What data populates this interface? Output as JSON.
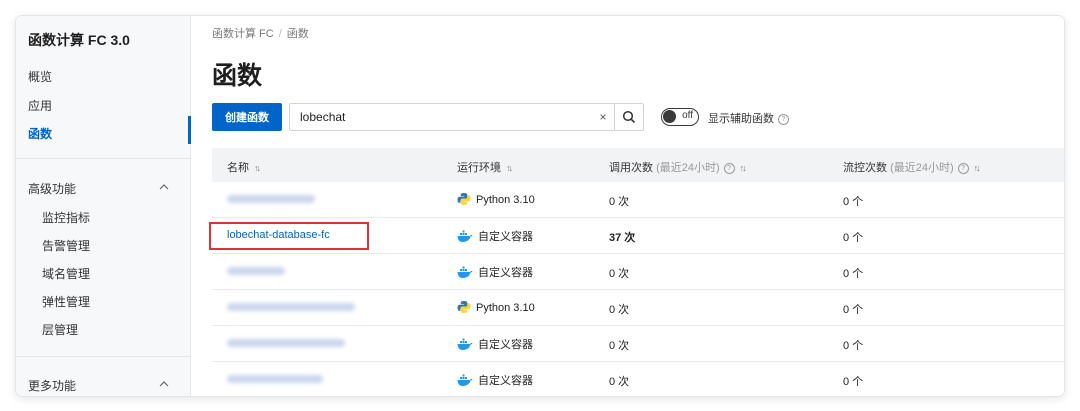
{
  "sidebar": {
    "title": "函数计算 FC 3.0",
    "items": [
      {
        "label": "概览"
      },
      {
        "label": "应用"
      },
      {
        "label": "函数"
      }
    ],
    "sections": [
      {
        "label": "高级功能",
        "items": [
          "监控指标",
          "告警管理",
          "域名管理",
          "弹性管理",
          "层管理"
        ]
      },
      {
        "label": "更多功能"
      }
    ]
  },
  "breadcrumb": {
    "root": "函数计算 FC",
    "separator": "/",
    "current": "函数"
  },
  "page": {
    "title": "函数"
  },
  "toolbar": {
    "create_label": "创建函数",
    "search_value": "lobechat",
    "clear_glyph": "×",
    "toggle_state": "off",
    "toggle_label": "显示辅助函数",
    "help_glyph": "?"
  },
  "table": {
    "headers": {
      "name": "名称",
      "runtime": "运行环境",
      "invocations": "调用次数",
      "invocations_sub": "(最近24小时)",
      "throttles": "流控次数",
      "throttles_sub": "(最近24小时)",
      "sort_glyph": "↑↓"
    },
    "rows": [
      {
        "runtime": "Python 3.10",
        "runtime_icon": "python-icon",
        "invocations": "0 次",
        "throttles": "0 个"
      },
      {
        "name": "lobechat-database-fc",
        "runtime": "自定义容器",
        "runtime_icon": "docker-icon",
        "invocations": "37 次",
        "throttles": "0 个"
      },
      {
        "runtime": "自定义容器",
        "runtime_icon": "docker-icon",
        "invocations": "0 次",
        "throttles": "0 个"
      },
      {
        "runtime": "Python 3.10",
        "runtime_icon": "python-icon",
        "invocations": "0 次",
        "throttles": "0 个"
      },
      {
        "runtime": "自定义容器",
        "runtime_icon": "docker-icon",
        "invocations": "0 次",
        "throttles": "0 个"
      },
      {
        "runtime": "自定义容器",
        "runtime_icon": "docker-icon",
        "invocations": "0 次",
        "throttles": "0 个"
      }
    ]
  },
  "colors": {
    "accent": "#0064c8",
    "highlight": "#e0332f",
    "python_blue": "#3776ab",
    "python_yellow": "#ffd43b",
    "docker_blue": "#2496ed"
  }
}
